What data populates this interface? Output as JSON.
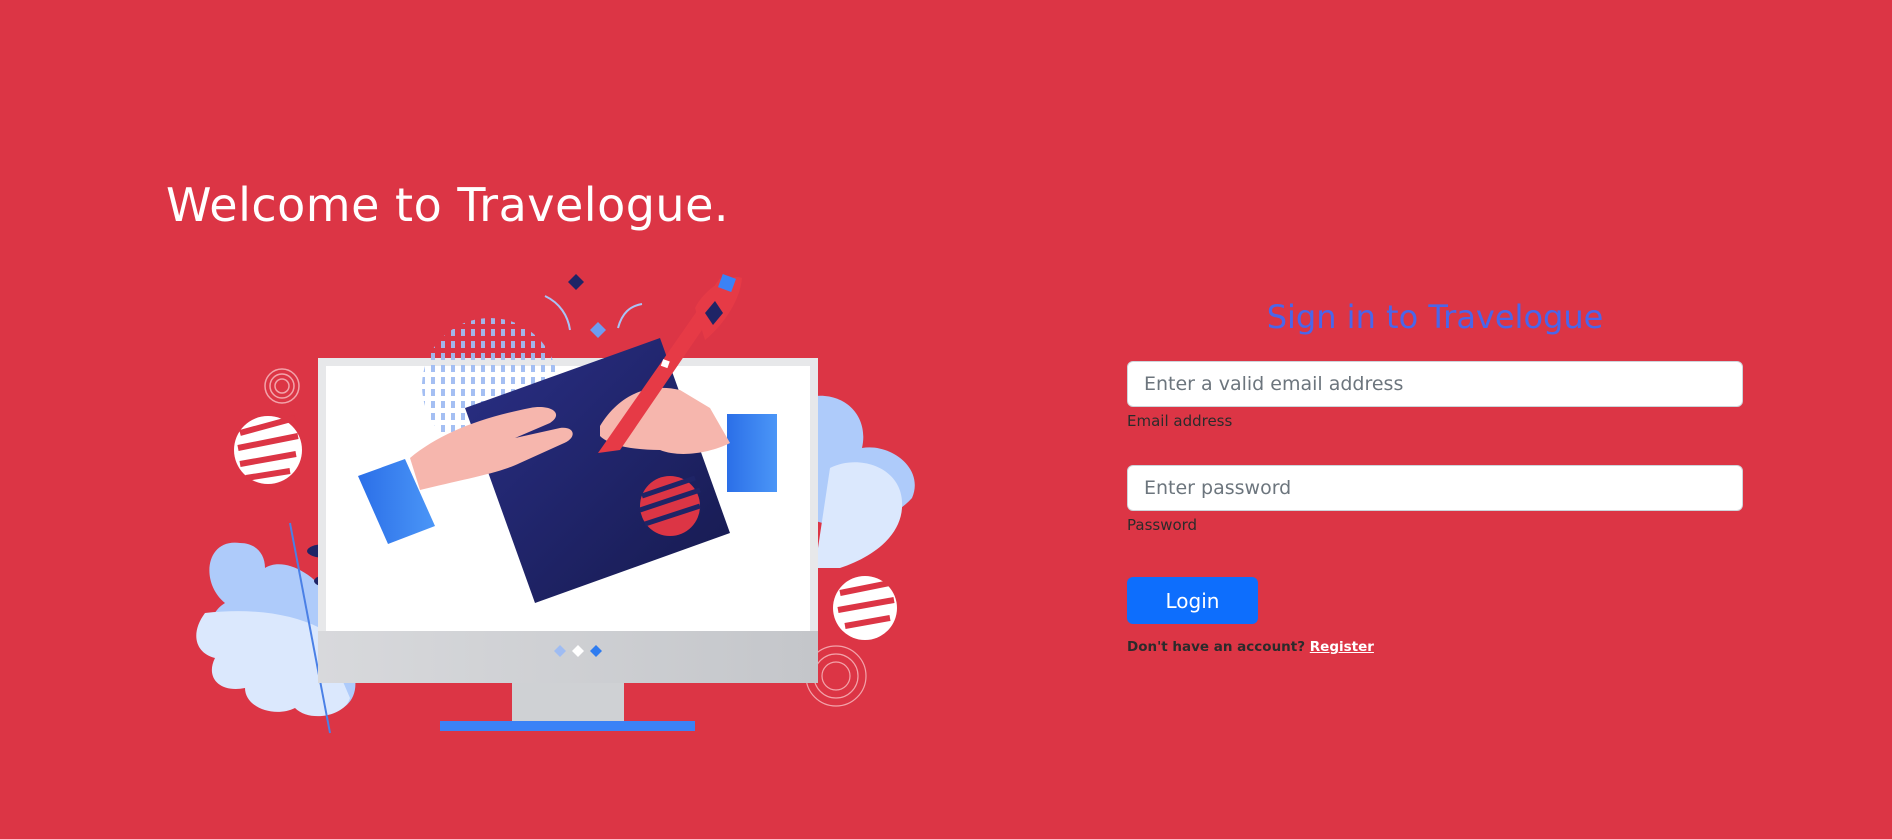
{
  "hero": {
    "welcome_title": "Welcome to Travelogue."
  },
  "login_form": {
    "title": "Sign in to Travelogue",
    "email": {
      "placeholder": "Enter a valid email address",
      "value": "",
      "label": "Email address"
    },
    "password": {
      "placeholder": "Enter password",
      "value": "",
      "label": "Password"
    },
    "login_label": "Login",
    "register_prompt": "Don't have an account?",
    "register_link": "Register"
  },
  "colors": {
    "background": "#dc3545",
    "title_blue": "#4a66ea",
    "primary_button": "#0d6efd",
    "illustration_navy": "#1f2466",
    "illustration_blue": "#2f7cf0"
  },
  "icons": [
    "computer-monitor-illustration",
    "tablet-illustration",
    "hand-illustration",
    "pen-illustration",
    "leaf-illustration"
  ]
}
